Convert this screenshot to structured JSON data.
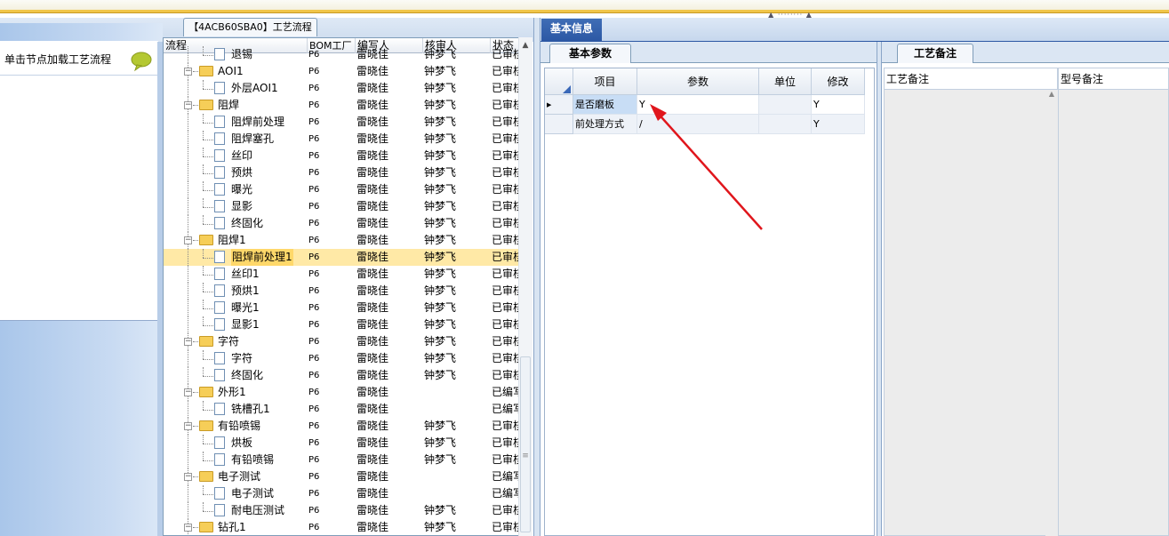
{
  "left_panel": {
    "hint_text": "单击节点加载工艺流程",
    "hint_icon": "speech-bubble-icon"
  },
  "center": {
    "tab_title": "【4ACB60SBA0】工艺流程",
    "columns": [
      "流程",
      "BOM工厂",
      "编写人",
      "核审人",
      "状态"
    ],
    "rows": [
      {
        "name": "退锡",
        "level": 1,
        "type": "file",
        "factory": "P6",
        "writer": "雷晓佳",
        "reviewer": "钟梦飞",
        "status": "已审核"
      },
      {
        "name": "AOI1",
        "level": 0,
        "type": "folder",
        "factory": "P6",
        "writer": "雷晓佳",
        "reviewer": "钟梦飞",
        "status": "已审核"
      },
      {
        "name": "外层AOI1",
        "level": 1,
        "type": "file",
        "factory": "P6",
        "writer": "雷晓佳",
        "reviewer": "钟梦飞",
        "status": "已审核"
      },
      {
        "name": "阻焊",
        "level": 0,
        "type": "folder",
        "factory": "P6",
        "writer": "雷晓佳",
        "reviewer": "钟梦飞",
        "status": "已审核"
      },
      {
        "name": "阻焊前处理",
        "level": 1,
        "type": "file",
        "factory": "P6",
        "writer": "雷晓佳",
        "reviewer": "钟梦飞",
        "status": "已审核"
      },
      {
        "name": "阻焊塞孔",
        "level": 1,
        "type": "file",
        "factory": "P6",
        "writer": "雷晓佳",
        "reviewer": "钟梦飞",
        "status": "已审核"
      },
      {
        "name": "丝印",
        "level": 1,
        "type": "file",
        "factory": "P6",
        "writer": "雷晓佳",
        "reviewer": "钟梦飞",
        "status": "已审核"
      },
      {
        "name": "预烘",
        "level": 1,
        "type": "file",
        "factory": "P6",
        "writer": "雷晓佳",
        "reviewer": "钟梦飞",
        "status": "已审核"
      },
      {
        "name": "曝光",
        "level": 1,
        "type": "file",
        "factory": "P6",
        "writer": "雷晓佳",
        "reviewer": "钟梦飞",
        "status": "已审核"
      },
      {
        "name": "显影",
        "level": 1,
        "type": "file",
        "factory": "P6",
        "writer": "雷晓佳",
        "reviewer": "钟梦飞",
        "status": "已审核"
      },
      {
        "name": "终固化",
        "level": 1,
        "type": "file",
        "factory": "P6",
        "writer": "雷晓佳",
        "reviewer": "钟梦飞",
        "status": "已审核"
      },
      {
        "name": "阻焊1",
        "level": 0,
        "type": "folder",
        "factory": "P6",
        "writer": "雷晓佳",
        "reviewer": "钟梦飞",
        "status": "已审核"
      },
      {
        "name": "阻焊前处理1",
        "level": 1,
        "type": "file",
        "factory": "P6",
        "writer": "雷晓佳",
        "reviewer": "钟梦飞",
        "status": "已审核",
        "selected": true
      },
      {
        "name": "丝印1",
        "level": 1,
        "type": "file",
        "factory": "P6",
        "writer": "雷晓佳",
        "reviewer": "钟梦飞",
        "status": "已审核"
      },
      {
        "name": "预烘1",
        "level": 1,
        "type": "file",
        "factory": "P6",
        "writer": "雷晓佳",
        "reviewer": "钟梦飞",
        "status": "已审核"
      },
      {
        "name": "曝光1",
        "level": 1,
        "type": "file",
        "factory": "P6",
        "writer": "雷晓佳",
        "reviewer": "钟梦飞",
        "status": "已审核"
      },
      {
        "name": "显影1",
        "level": 1,
        "type": "file",
        "factory": "P6",
        "writer": "雷晓佳",
        "reviewer": "钟梦飞",
        "status": "已审核"
      },
      {
        "name": "字符",
        "level": 0,
        "type": "folder",
        "factory": "P6",
        "writer": "雷晓佳",
        "reviewer": "钟梦飞",
        "status": "已审核"
      },
      {
        "name": "字符",
        "level": 1,
        "type": "file",
        "factory": "P6",
        "writer": "雷晓佳",
        "reviewer": "钟梦飞",
        "status": "已审核"
      },
      {
        "name": "终固化",
        "level": 1,
        "type": "file",
        "factory": "P6",
        "writer": "雷晓佳",
        "reviewer": "钟梦飞",
        "status": "已审核"
      },
      {
        "name": "外形1",
        "level": 0,
        "type": "folder",
        "factory": "P6",
        "writer": "雷晓佳",
        "reviewer": "",
        "status": "已编写"
      },
      {
        "name": "铣槽孔1",
        "level": 1,
        "type": "file",
        "factory": "P6",
        "writer": "雷晓佳",
        "reviewer": "",
        "status": "已编写"
      },
      {
        "name": "有铅喷锡",
        "level": 0,
        "type": "folder",
        "factory": "P6",
        "writer": "雷晓佳",
        "reviewer": "钟梦飞",
        "status": "已审核"
      },
      {
        "name": "烘板",
        "level": 1,
        "type": "file",
        "factory": "P6",
        "writer": "雷晓佳",
        "reviewer": "钟梦飞",
        "status": "已审核"
      },
      {
        "name": "有铅喷锡",
        "level": 1,
        "type": "file",
        "factory": "P6",
        "writer": "雷晓佳",
        "reviewer": "钟梦飞",
        "status": "已审核"
      },
      {
        "name": "电子测试",
        "level": 0,
        "type": "folder",
        "factory": "P6",
        "writer": "雷晓佳",
        "reviewer": "",
        "status": "已编写"
      },
      {
        "name": "电子测试",
        "level": 1,
        "type": "file",
        "factory": "P6",
        "writer": "雷晓佳",
        "reviewer": "",
        "status": "已编写"
      },
      {
        "name": "耐电压测试",
        "level": 1,
        "type": "file",
        "factory": "P6",
        "writer": "雷晓佳",
        "reviewer": "钟梦飞",
        "status": "已审核"
      },
      {
        "name": "钻孔1",
        "level": 0,
        "type": "folder",
        "factory": "P6",
        "writer": "雷晓佳",
        "reviewer": "钟梦飞",
        "status": "已审核"
      }
    ]
  },
  "basic_info": {
    "tab_label": "基本信息",
    "sub_tab_label": "基本参数",
    "columns": [
      "项目",
      "参数",
      "单位",
      "修改"
    ],
    "rows": [
      {
        "item": "是否磨板",
        "param": "Y",
        "unit": "",
        "modify": "Y",
        "current": true
      },
      {
        "item": "前处理方式",
        "param": "/",
        "unit": "",
        "modify": "Y",
        "current": false
      }
    ]
  },
  "notes": {
    "tab_label": "工艺备注",
    "process_note_header": "工艺备注",
    "model_note_header": "型号备注"
  },
  "colors": {
    "selection": "#ffe9a6",
    "tab_active": "#2c58a4",
    "arrow": "#e0161c"
  }
}
